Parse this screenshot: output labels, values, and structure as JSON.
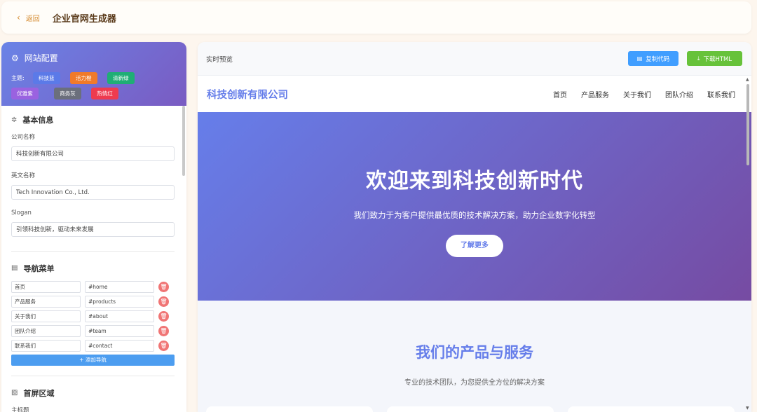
{
  "header": {
    "back_label": "返回",
    "title": "企业官网生成器"
  },
  "config": {
    "title": "网站配置",
    "theme_label": "主题:",
    "themes": [
      {
        "label": "科技蓝",
        "color": "#5b7ae8"
      },
      {
        "label": "活力橙",
        "color": "#f07a2a"
      },
      {
        "label": "清新绿",
        "color": "#1fae75"
      },
      {
        "label": "优雅紫",
        "color": "#9a62e0"
      },
      {
        "label": "商务灰",
        "color": "#6b6f7c"
      },
      {
        "label": "热情红",
        "color": "#ee3b4f"
      }
    ]
  },
  "basic": {
    "title": "基本信息",
    "company_label": "公司名称",
    "company_value": "科技创新有限公司",
    "english_label": "英文名称",
    "english_value": "Tech Innovation Co., Ltd.",
    "slogan_label": "Slogan",
    "slogan_value": "引领科技创新，驱动未来发展"
  },
  "nav": {
    "title": "导航菜单",
    "items": [
      {
        "name": "首页",
        "link": "#home"
      },
      {
        "name": "产品服务",
        "link": "#products"
      },
      {
        "name": "关于我们",
        "link": "#about"
      },
      {
        "name": "团队介绍",
        "link": "#team"
      },
      {
        "name": "联系我们",
        "link": "#contact"
      }
    ],
    "add_label": "+ 添加导航"
  },
  "hero_section": {
    "title": "首屏区域",
    "main_title_label": "主标题"
  },
  "preview": {
    "label": "实时预览",
    "copy_label": "复制代码",
    "download_label": "下载HTML",
    "logo": "科技创新有限公司",
    "menu": [
      "首页",
      "产品服务",
      "关于我们",
      "团队介绍",
      "联系我们"
    ],
    "hero_title": "欢迎来到科技创新时代",
    "hero_subtitle": "我们致力于为客户提供最优质的技术解决方案，助力企业数字化转型",
    "hero_cta": "了解更多",
    "products_title": "我们的产品与服务",
    "products_subtitle": "专业的技术团队，为您提供全方位的解决方案"
  }
}
